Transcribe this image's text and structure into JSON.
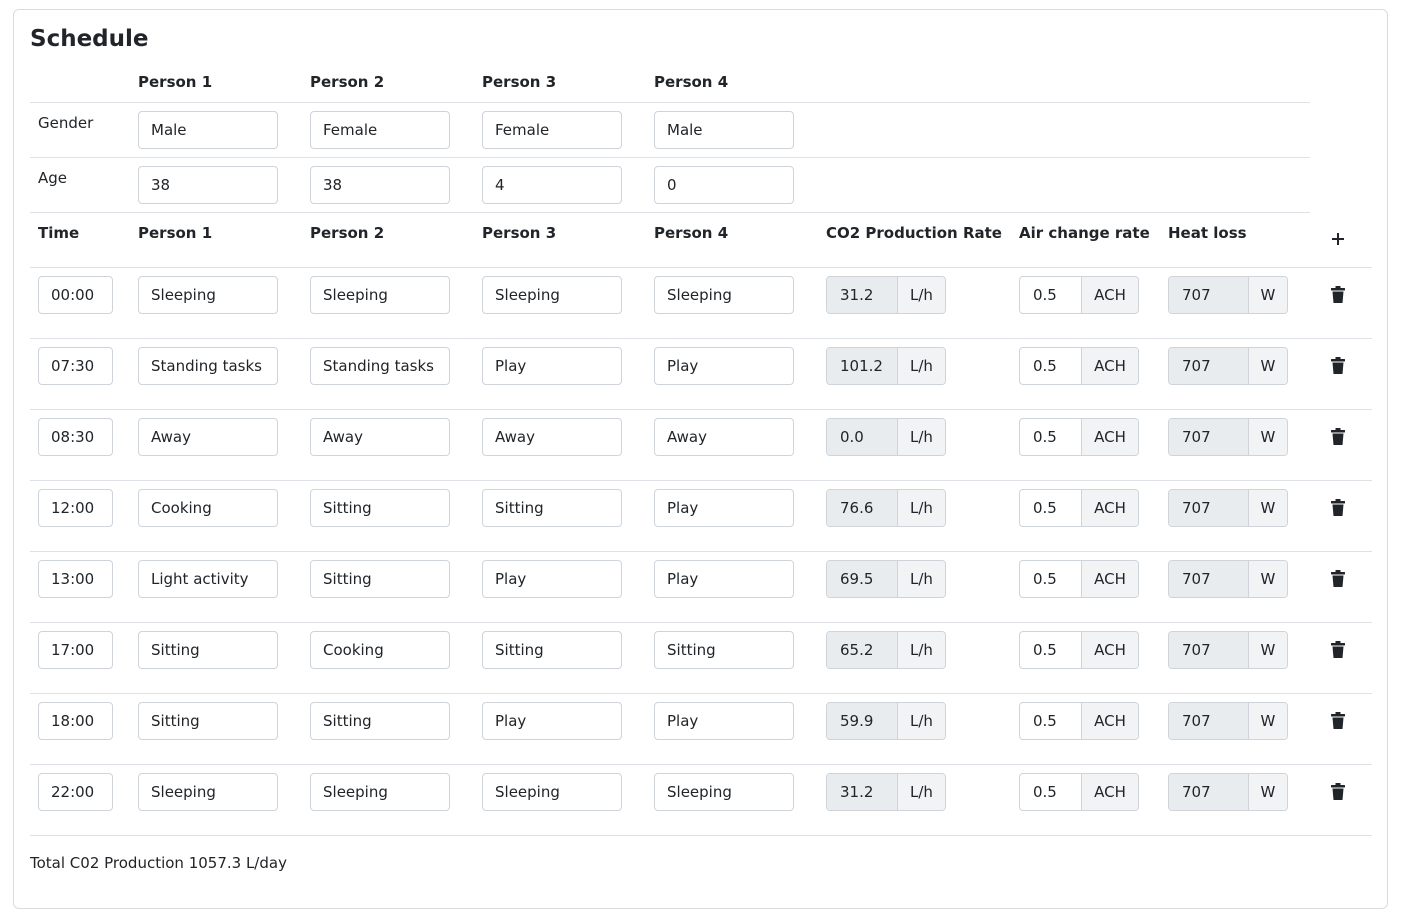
{
  "title": "Schedule",
  "people_headers": [
    "Person 1",
    "Person 2",
    "Person 3",
    "Person 4"
  ],
  "gender_label": "Gender",
  "age_label": "Age",
  "genders": [
    "Male",
    "Female",
    "Female",
    "Male"
  ],
  "ages": [
    "38",
    "38",
    "4",
    "0"
  ],
  "schedule_headers": {
    "time": "Time",
    "persons": [
      "Person 1",
      "Person 2",
      "Person 3",
      "Person 4"
    ],
    "co2": "CO2 Production Rate",
    "ach": "Air change rate",
    "heat": "Heat loss"
  },
  "units": {
    "co2": "L/h",
    "ach": "ACH",
    "heat": "W"
  },
  "rows": [
    {
      "time": "00:00",
      "activities": [
        "Sleeping",
        "Sleeping",
        "Sleeping",
        "Sleeping"
      ],
      "co2": "31.2",
      "ach": "0.5",
      "heat": "707"
    },
    {
      "time": "07:30",
      "activities": [
        "Standing tasks",
        "Standing tasks",
        "Play",
        "Play"
      ],
      "co2": "101.2",
      "ach": "0.5",
      "heat": "707"
    },
    {
      "time": "08:30",
      "activities": [
        "Away",
        "Away",
        "Away",
        "Away"
      ],
      "co2": "0.0",
      "ach": "0.5",
      "heat": "707"
    },
    {
      "time": "12:00",
      "activities": [
        "Cooking",
        "Sitting",
        "Sitting",
        "Play"
      ],
      "co2": "76.6",
      "ach": "0.5",
      "heat": "707"
    },
    {
      "time": "13:00",
      "activities": [
        "Light activity",
        "Sitting",
        "Play",
        "Play"
      ],
      "co2": "69.5",
      "ach": "0.5",
      "heat": "707"
    },
    {
      "time": "17:00",
      "activities": [
        "Sitting",
        "Cooking",
        "Sitting",
        "Sitting"
      ],
      "co2": "65.2",
      "ach": "0.5",
      "heat": "707"
    },
    {
      "time": "18:00",
      "activities": [
        "Sitting",
        "Sitting",
        "Play",
        "Play"
      ],
      "co2": "59.9",
      "ach": "0.5",
      "heat": "707"
    },
    {
      "time": "22:00",
      "activities": [
        "Sleeping",
        "Sleeping",
        "Sleeping",
        "Sleeping"
      ],
      "co2": "31.2",
      "ach": "0.5",
      "heat": "707"
    }
  ],
  "total_text": "Total C02 Production 1057.3 L/day",
  "icons": {
    "add": "plus-icon",
    "delete": "trash-icon"
  }
}
